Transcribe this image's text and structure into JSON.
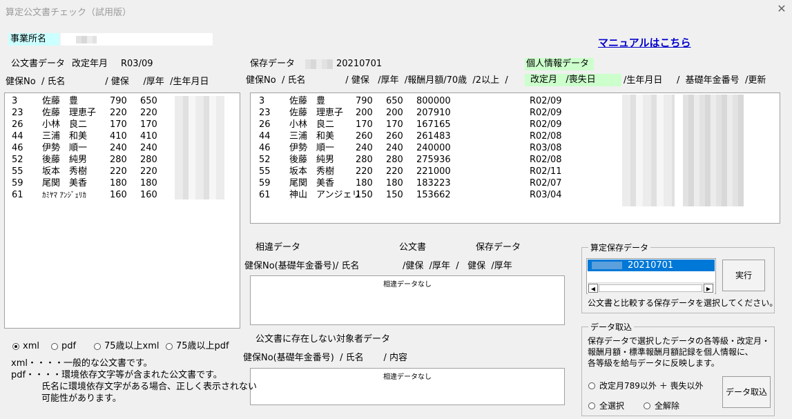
{
  "window": {
    "title": "算定公文書チェック（試用版）",
    "close_glyph": "✕"
  },
  "office": {
    "label": "事業所名"
  },
  "manual_link": "マニュアルはこちら",
  "left": {
    "header_label": "公文書データ",
    "revision_label": "改定年月",
    "revision_value": "R03/09",
    "columns": "健保No  / 氏名              / 健保     /厚年  /生年月日",
    "rows": [
      {
        "no": "3",
        "name": "佐藤　豊",
        "kenpo": "790",
        "kounen": "650"
      },
      {
        "no": "23",
        "name": "佐藤　理恵子",
        "kenpo": "220",
        "kounen": "220"
      },
      {
        "no": "26",
        "name": "小林　良二",
        "kenpo": "170",
        "kounen": "170"
      },
      {
        "no": "44",
        "name": "三浦　和美",
        "kenpo": "410",
        "kounen": "410"
      },
      {
        "no": "46",
        "name": "伊勢　順一",
        "kenpo": "240",
        "kounen": "240"
      },
      {
        "no": "52",
        "name": "後藤　純男",
        "kenpo": "280",
        "kounen": "280"
      },
      {
        "no": "55",
        "name": "坂本　秀樹",
        "kenpo": "220",
        "kounen": "220"
      },
      {
        "no": "59",
        "name": "尾関　美香",
        "kenpo": "180",
        "kounen": "180"
      },
      {
        "no": "61",
        "name": "ｶﾐﾔﾏ ｱﾝｼﾞｪﾘｶ",
        "kenpo": "160",
        "kounen": "160"
      }
    ]
  },
  "saved": {
    "header_label": "保存データ",
    "saved_value": "20210701",
    "personal_label": "個人情報データ",
    "columns_a": "健保No  / 氏名              / 健保   /厚年  /報酬月額/70歳  /2以上  /",
    "columns_b": "改定月   /喪失日",
    "columns_c": "/生年月日     /  基礎年金番号  /更新",
    "rows": [
      {
        "no": "3",
        "name": "佐藤　豊",
        "kenpo": "790",
        "kounen": "650",
        "salary": "800000",
        "rev": "R02/09"
      },
      {
        "no": "23",
        "name": "佐藤　理恵子",
        "kenpo": "200",
        "kounen": "200",
        "salary": "207910",
        "rev": "R02/09"
      },
      {
        "no": "26",
        "name": "小林　良二",
        "kenpo": "170",
        "kounen": "170",
        "salary": "167165",
        "rev": "R02/09"
      },
      {
        "no": "44",
        "name": "三浦　和美",
        "kenpo": "260",
        "kounen": "260",
        "salary": "261483",
        "rev": "R02/08"
      },
      {
        "no": "46",
        "name": "伊勢　順一",
        "kenpo": "240",
        "kounen": "240",
        "salary": "240000",
        "rev": "R03/08"
      },
      {
        "no": "52",
        "name": "後藤　純男",
        "kenpo": "280",
        "kounen": "280",
        "salary": "275936",
        "rev": "R02/08"
      },
      {
        "no": "55",
        "name": "坂本　秀樹",
        "kenpo": "220",
        "kounen": "220",
        "salary": "221000",
        "rev": "R02/11"
      },
      {
        "no": "59",
        "name": "尾関　美香",
        "kenpo": "180",
        "kounen": "180",
        "salary": "183223",
        "rev": "R02/07"
      },
      {
        "no": "61",
        "name": "神山　アンジェリ",
        "kenpo": "150",
        "kounen": "150",
        "salary": "153662",
        "rev": "R03/04"
      }
    ]
  },
  "diff": {
    "label_left": "相違データ",
    "label_mid": "公文書",
    "label_right": "保存データ",
    "columns_left": "健保No(基礎年金番号)/ 氏名",
    "columns_right": "/健保  /厚年  /   健保  /厚年",
    "empty": "相違データなし"
  },
  "missing": {
    "label": "公文書に存在しない対象者データ",
    "columns": "健保No(基礎年金番号)  / 氏名       / 内容",
    "empty": "相違データなし"
  },
  "calc_saved": {
    "group_title": "算定保存データ",
    "selected_item": "20210701",
    "scroll_left": "◀",
    "scroll_right": "▶",
    "execute_button": "実行",
    "hint": "公文書と比較する保存データを選択してください。"
  },
  "import": {
    "group_title": "データ取込",
    "description_1": "保存データで選択したデータの各等級・改定月・",
    "description_2": "報酬月額・標準報酬月額記録を個人情報に、",
    "description_3": "各等級を給与データに反映します。",
    "option_except": "改定月789以外 ＋ 喪失以外",
    "option_all": "全選択",
    "option_clear": "全解除",
    "import_button": "データ取込"
  },
  "format": {
    "options": [
      "xml",
      "pdf",
      "75歳以上xml",
      "75歳以上pdf"
    ],
    "selected": "xml",
    "note_xml": "xml・・・・一般的な公文書です。",
    "note_pdf_1": "pdf・・・・環境依存文字等が含まれた公文書です。",
    "note_pdf_2": "氏名に環境依存文字がある場合、正しく表示されない",
    "note_pdf_3": "可能性があります。"
  },
  "colors": {
    "cyan": "#ccffff",
    "green": "#ccffcc",
    "link": "#0000cc",
    "selection": "#0078d7"
  }
}
